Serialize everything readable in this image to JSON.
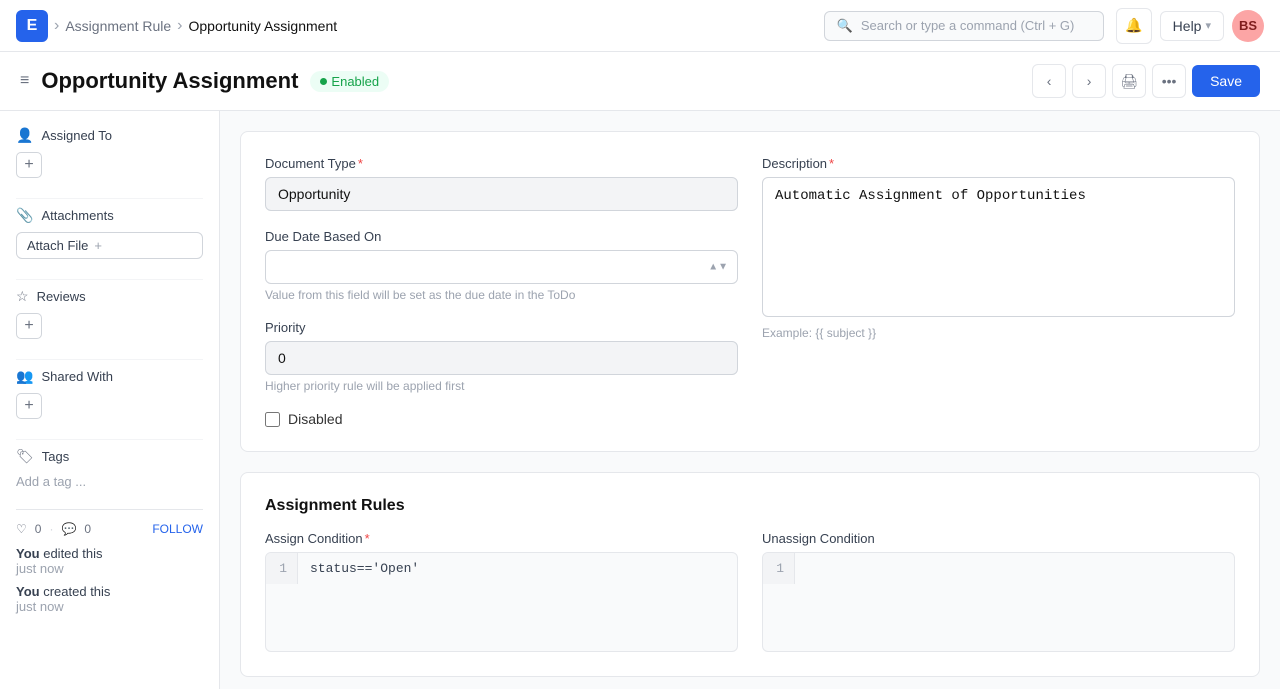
{
  "nav": {
    "logo": "E",
    "breadcrumb1": "Assignment Rule",
    "breadcrumb2": "Opportunity Assignment",
    "search_placeholder": "Search or type a command (Ctrl + G)",
    "help_label": "Help",
    "avatar": "BS"
  },
  "header": {
    "menu_icon": "≡",
    "title": "Opportunity Assignment",
    "status": "Enabled",
    "save_label": "Save"
  },
  "sidebar": {
    "assigned_to_label": "Assigned To",
    "attachments_label": "Attachments",
    "attach_file_label": "Attach File",
    "reviews_label": "Reviews",
    "shared_with_label": "Shared With",
    "tags_label": "Tags",
    "add_tag_label": "Add a tag ..."
  },
  "activity": {
    "likes": "0",
    "comments": "0",
    "follow_label": "FOLLOW",
    "items": [
      {
        "prefix": "You",
        "action": "edited this",
        "time": "just now"
      },
      {
        "prefix": "You",
        "action": "created this",
        "time": "just now"
      }
    ]
  },
  "form": {
    "document_type_label": "Document Type",
    "document_type_required": true,
    "document_type_value": "Opportunity",
    "description_label": "Description",
    "description_required": true,
    "description_value": "Automatic Assignment of Opportunities",
    "due_date_label": "Due Date Based On",
    "due_date_hint": "Value from this field will be set as the due date in the ToDo",
    "priority_label": "Priority",
    "priority_value": "0",
    "priority_hint": "Higher priority rule will be applied first",
    "disabled_label": "Disabled",
    "example_text": "Example: {{ subject }}"
  },
  "assignment_rules": {
    "section_title": "Assignment Rules",
    "assign_condition_label": "Assign Condition",
    "assign_condition_required": true,
    "assign_condition_code": "status=='Open'",
    "assign_condition_lineno": "1",
    "unassign_condition_label": "Unassign Condition",
    "unassign_condition_lineno": "1"
  }
}
